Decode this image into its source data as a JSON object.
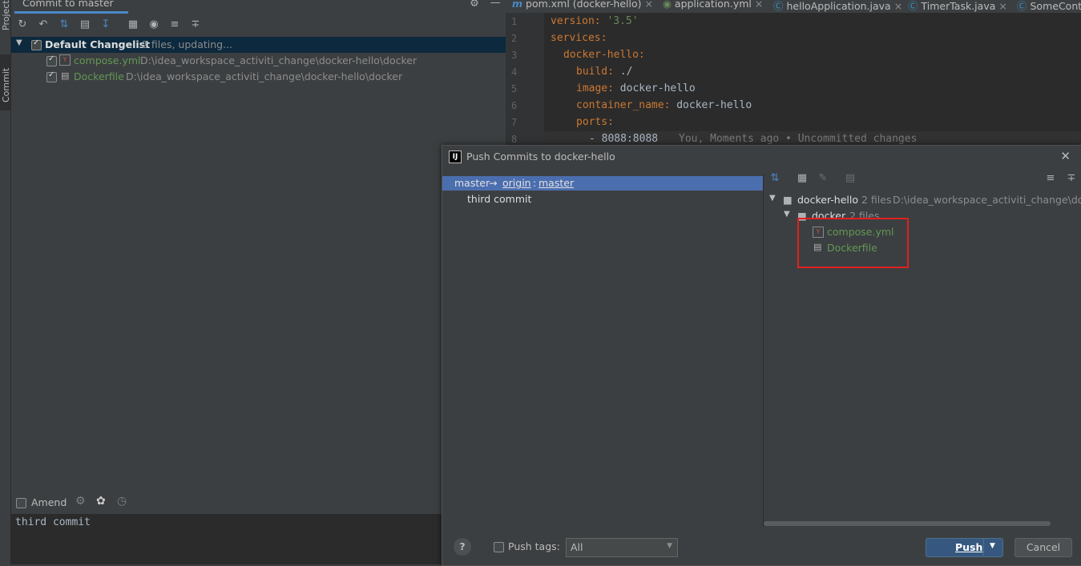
{
  "left_strip": {
    "project_tab": "Project",
    "commit_tab": "Commit"
  },
  "commit_panel": {
    "title": "Commit to master",
    "changelist": {
      "name": "Default Changelist",
      "status": "2 files, updating..."
    },
    "files": [
      {
        "name": "compose.yml",
        "path": "D:\\idea_workspace_activiti_change\\docker-hello\\docker",
        "icon": "yaml-file-icon"
      },
      {
        "name": "Dockerfile",
        "path": "D:\\idea_workspace_activiti_change\\docker-hello\\docker",
        "icon": "text-file-icon"
      }
    ],
    "amend_label": "Amend",
    "commit_message": "third commit"
  },
  "editor": {
    "tabs": [
      {
        "label": "pom.xml (docker-hello)",
        "icon": "m"
      },
      {
        "label": "application.yml",
        "icon": "spring-leaf-icon"
      },
      {
        "label": "helloApplication.java",
        "icon": "c"
      },
      {
        "label": "TimerTask.java",
        "icon": "c"
      },
      {
        "label": "SomeCont",
        "icon": "c"
      }
    ],
    "lines": [
      {
        "no": "1",
        "key": "version",
        "value": "'3.5'",
        "indent": 0
      },
      {
        "no": "2",
        "key": "services",
        "value": "",
        "indent": 0
      },
      {
        "no": "3",
        "key": "docker-hello",
        "value": "",
        "indent": 1
      },
      {
        "no": "4",
        "key": "build",
        "value": "./",
        "indent": 2
      },
      {
        "no": "5",
        "key": "image",
        "value": "docker-hello",
        "indent": 2
      },
      {
        "no": "6",
        "key": "container_name",
        "value": "docker-hello",
        "indent": 2
      },
      {
        "no": "7",
        "key": "ports",
        "value": "",
        "indent": 2
      },
      {
        "no": "8",
        "key": "",
        "value": "- 8088:8088",
        "indent": 3
      }
    ],
    "blame_annotation": "You, Moments ago • Uncommitted changes"
  },
  "push_dialog": {
    "title": "Push Commits to docker-hello",
    "branch": {
      "local": "master",
      "arrow": "→",
      "remote": "origin",
      "sep": ":",
      "remote_branch": "master"
    },
    "commits": [
      "third commit"
    ],
    "tree": {
      "root": {
        "name": "docker-hello",
        "count": "2 files",
        "path": "D:\\idea_workspace_activiti_change\\docke"
      },
      "folder": {
        "name": "docker",
        "count": "2 files"
      },
      "files": [
        {
          "name": "compose.yml",
          "icon": "yaml-file-icon"
        },
        {
          "name": "Dockerfile",
          "icon": "text-file-icon"
        }
      ]
    },
    "push_tags_label": "Push tags:",
    "tags_option": "All",
    "push_label": "Push",
    "cancel_label": "Cancel",
    "help_label": "?"
  },
  "colors": {
    "accent": "#4a88c7",
    "selection": "#4b6eaf",
    "file_modified": "#629755",
    "highlight_box": "#e02020"
  }
}
